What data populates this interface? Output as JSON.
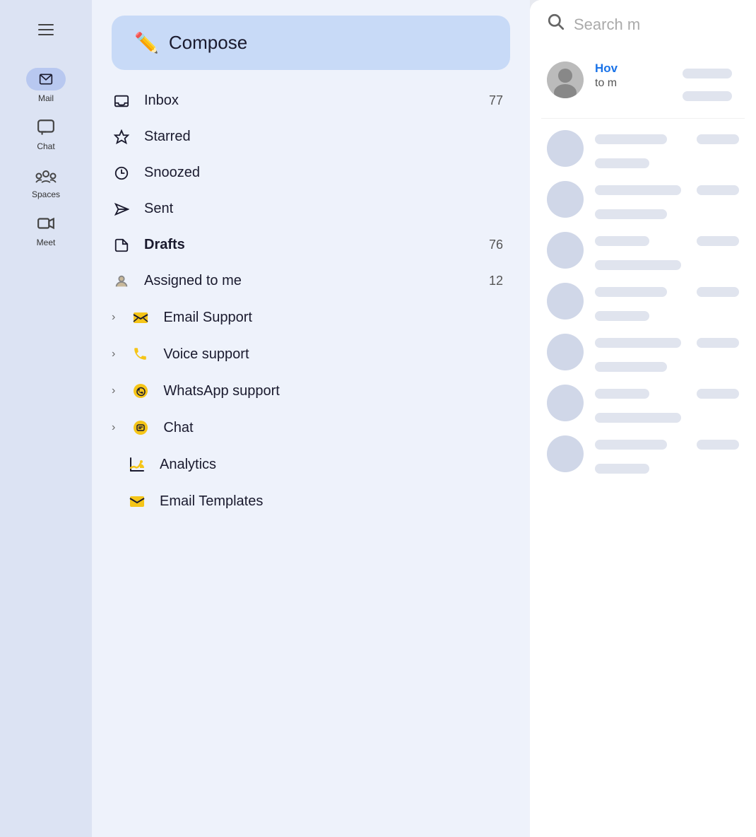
{
  "nav": {
    "hamburger_label": "Menu",
    "items": [
      {
        "id": "mail",
        "label": "Mail",
        "active": true
      },
      {
        "id": "chat",
        "label": "Chat",
        "active": false
      },
      {
        "id": "spaces",
        "label": "Spaces",
        "active": false
      },
      {
        "id": "meet",
        "label": "Meet",
        "active": false
      }
    ]
  },
  "sidebar": {
    "compose_label": "Compose",
    "items": [
      {
        "id": "inbox",
        "label": "Inbox",
        "count": "77",
        "bold": false,
        "expandable": false
      },
      {
        "id": "starred",
        "label": "Starred",
        "count": "",
        "bold": false,
        "expandable": false
      },
      {
        "id": "snoozed",
        "label": "Snoozed",
        "count": "",
        "bold": false,
        "expandable": false
      },
      {
        "id": "sent",
        "label": "Sent",
        "count": "",
        "bold": false,
        "expandable": false
      },
      {
        "id": "drafts",
        "label": "Drafts",
        "count": "76",
        "bold": true,
        "expandable": false
      },
      {
        "id": "assigned",
        "label": "Assigned to me",
        "count": "12",
        "bold": false,
        "expandable": false
      },
      {
        "id": "email-support",
        "label": "Email Support",
        "count": "",
        "bold": false,
        "expandable": true
      },
      {
        "id": "voice-support",
        "label": "Voice support",
        "count": "",
        "bold": false,
        "expandable": true
      },
      {
        "id": "whatsapp-support",
        "label": "WhatsApp support",
        "count": "",
        "bold": false,
        "expandable": true
      },
      {
        "id": "chat",
        "label": "Chat",
        "count": "",
        "bold": false,
        "expandable": true
      },
      {
        "id": "analytics",
        "label": "Analytics",
        "count": "",
        "bold": false,
        "expandable": false
      },
      {
        "id": "email-templates",
        "label": "Email Templates",
        "count": "",
        "bold": false,
        "expandable": false
      }
    ]
  },
  "search": {
    "placeholder": "Search m"
  },
  "email_preview": {
    "sender": "Hov",
    "subject": "to m"
  },
  "skeleton_lines": [
    "short",
    "medium",
    "long",
    "short",
    "medium",
    "long",
    "short",
    "medium"
  ]
}
